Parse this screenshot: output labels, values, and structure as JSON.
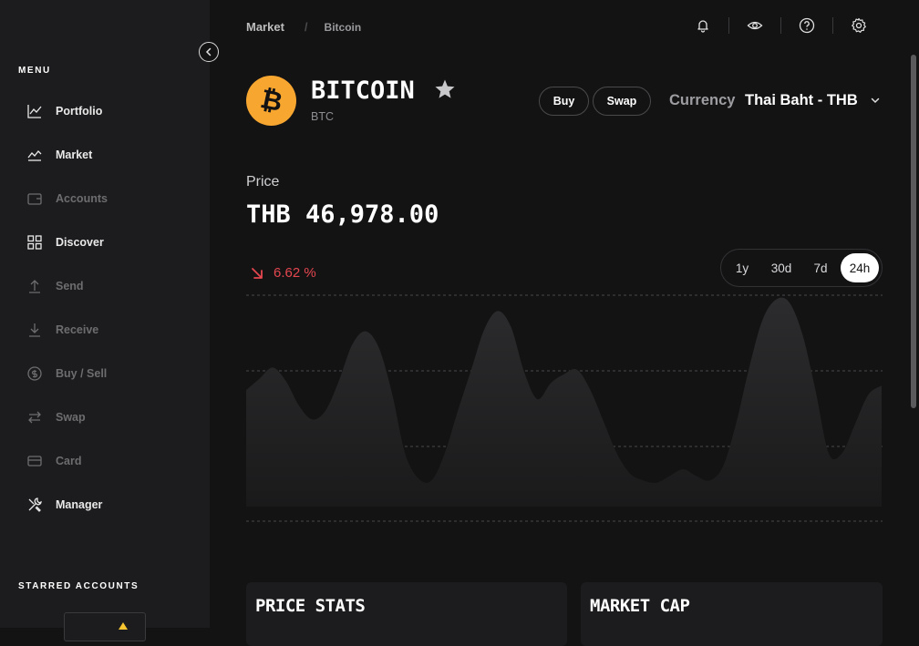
{
  "sidebar": {
    "menu_label": "MENU",
    "items": [
      {
        "label": "Portfolio",
        "icon": "line-chart-icon",
        "active": true
      },
      {
        "label": "Market",
        "icon": "area-chart-icon",
        "active": true
      },
      {
        "label": "Accounts",
        "icon": "wallet-icon",
        "active": false
      },
      {
        "label": "Discover",
        "icon": "grid-icon",
        "active": true
      },
      {
        "label": "Send",
        "icon": "arrow-up-icon",
        "active": false
      },
      {
        "label": "Receive",
        "icon": "arrow-down-icon",
        "active": false
      },
      {
        "label": "Buy / Sell",
        "icon": "dollar-circle-icon",
        "active": false
      },
      {
        "label": "Swap",
        "icon": "swap-arrows-icon",
        "active": false
      },
      {
        "label": "Card",
        "icon": "card-icon",
        "active": false
      },
      {
        "label": "Manager",
        "icon": "tools-icon",
        "active": true
      }
    ],
    "starred_label": "STARRED ACCOUNTS"
  },
  "breadcrumb": {
    "parent": "Market",
    "separator": "/",
    "current": "Bitcoin"
  },
  "top_icons": [
    "bell-icon",
    "eye-icon",
    "help-icon",
    "settings-icon"
  ],
  "coin": {
    "name": "BITCOIN",
    "symbol": "BTC",
    "logo_glyph": "₿",
    "logo_color": "#f7a630",
    "starred": true
  },
  "actions": {
    "buy": "Buy",
    "swap": "Swap"
  },
  "currency": {
    "label": "Currency",
    "value": "Thai Baht - THB"
  },
  "price": {
    "label": "Price",
    "value": "THB 46,978.00"
  },
  "change": {
    "value": "6.62 %",
    "direction": "down",
    "color": "#e5474f"
  },
  "ranges": {
    "options": [
      "1y",
      "30d",
      "7d",
      "24h"
    ],
    "selected": "24h"
  },
  "chart_data": {
    "type": "area",
    "title": "",
    "xlabel": "",
    "ylabel": "",
    "ylim": [
      0,
      100
    ],
    "grid": true,
    "x": [
      0,
      1,
      2,
      3,
      4,
      5,
      6,
      7,
      8,
      9,
      10,
      11,
      12,
      13,
      14,
      15,
      16,
      17,
      18,
      19,
      20,
      21,
      22,
      23,
      24,
      25,
      26,
      27,
      28,
      29,
      30,
      31,
      32,
      33,
      34,
      35,
      36,
      37,
      38,
      39,
      40,
      41,
      42,
      43,
      44,
      45,
      46,
      47,
      48,
      49,
      50,
      51,
      52,
      53,
      54,
      55,
      56,
      57,
      58,
      59,
      60,
      61,
      62,
      63,
      64,
      65,
      66,
      67,
      68,
      69,
      70,
      71,
      72,
      73,
      74,
      75,
      76,
      77,
      78,
      79,
      80
    ],
    "values": [
      58,
      63,
      68,
      62,
      51,
      45,
      49,
      62,
      78,
      84,
      77,
      57,
      30,
      19,
      18,
      30,
      49,
      67,
      85,
      93,
      86,
      66,
      54,
      61,
      65,
      67,
      58,
      44,
      30,
      21,
      18,
      17,
      20,
      23,
      20,
      18,
      24,
      43,
      68,
      89,
      98,
      97,
      83,
      58,
      30,
      30,
      43,
      56,
      60
    ]
  },
  "cards": [
    {
      "title": "PRICE STATS"
    },
    {
      "title": "MARKET CAP"
    }
  ],
  "colors": {
    "background": "#131314",
    "sidebar": "#1c1c1e",
    "accent": "#f7a630",
    "negative": "#e5474f"
  }
}
